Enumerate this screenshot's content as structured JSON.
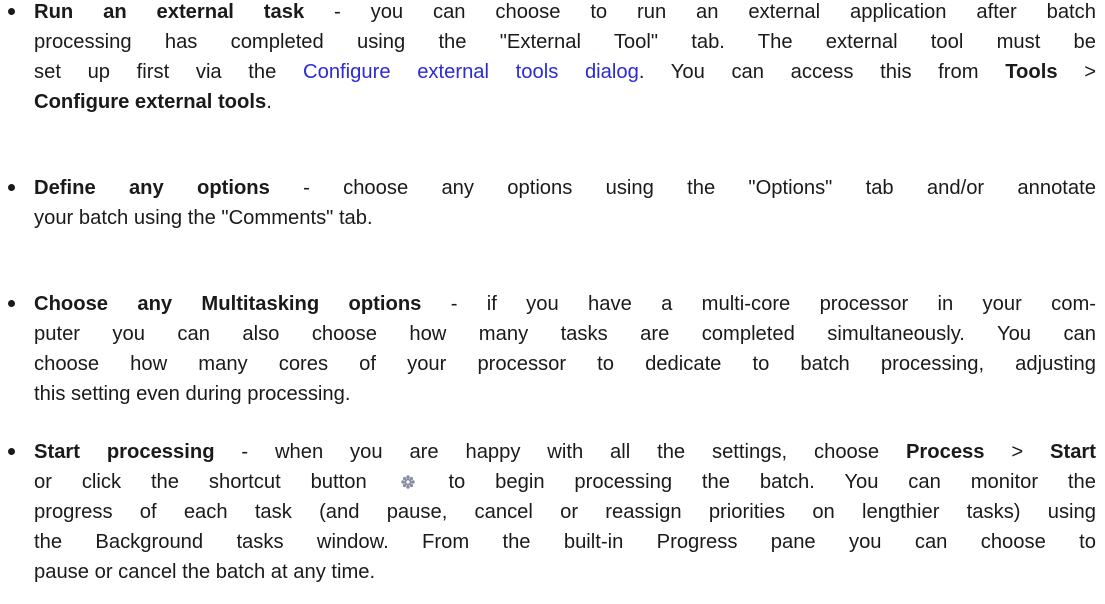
{
  "items": [
    {
      "heading": "Run an external task",
      "sep": " - ",
      "l1": "you can choose to run an external application after batch",
      "l2": "processing has completed using the \"External Tool\" tab.  The external tool must be",
      "l3_pre": "set up first via the ",
      "l3_link": "Configure external tools dialog",
      "l3_post": ".  You can access this from ",
      "menu_a": "Tools",
      "arrow": " > ",
      "menu_b": "Configure external tools",
      "l4_post": "."
    },
    {
      "heading": "Define any options",
      "sep": " - ",
      "l1": "choose any options using the \"Options\" tab and/or annotate",
      "l2": "your batch using the \"Comments\" tab."
    },
    {
      "heading": "Choose any Multitasking options",
      "sep": " - ",
      "l1": "if you have a multi-core processor in your com-",
      "l2": "puter you can also choose how many tasks are completed simultaneously.  You can",
      "l3": "choose how many cores of your processor to dedicate to batch processing, adjusting",
      "l4": "this setting even during processing."
    },
    {
      "heading": "Start processing",
      "sep": " - ",
      "l1": "when you are happy with all the settings, choose ",
      "menu_a": "Process",
      "arrow": " > ",
      "menu_b": "Start",
      "l2_pre": "or click the shortcut button ",
      "l2_post": " to begin processing the batch.  You can monitor the",
      "l3": "progress of each task (and pause, cancel or reassign priorities on lengthier tasks) using",
      "l4": "the Background tasks window.  From the built-in Progress pane you can choose to",
      "l5": "pause or cancel the batch at any time."
    }
  ],
  "icons": {
    "shortcut_button": "process-start-gear-icon"
  }
}
